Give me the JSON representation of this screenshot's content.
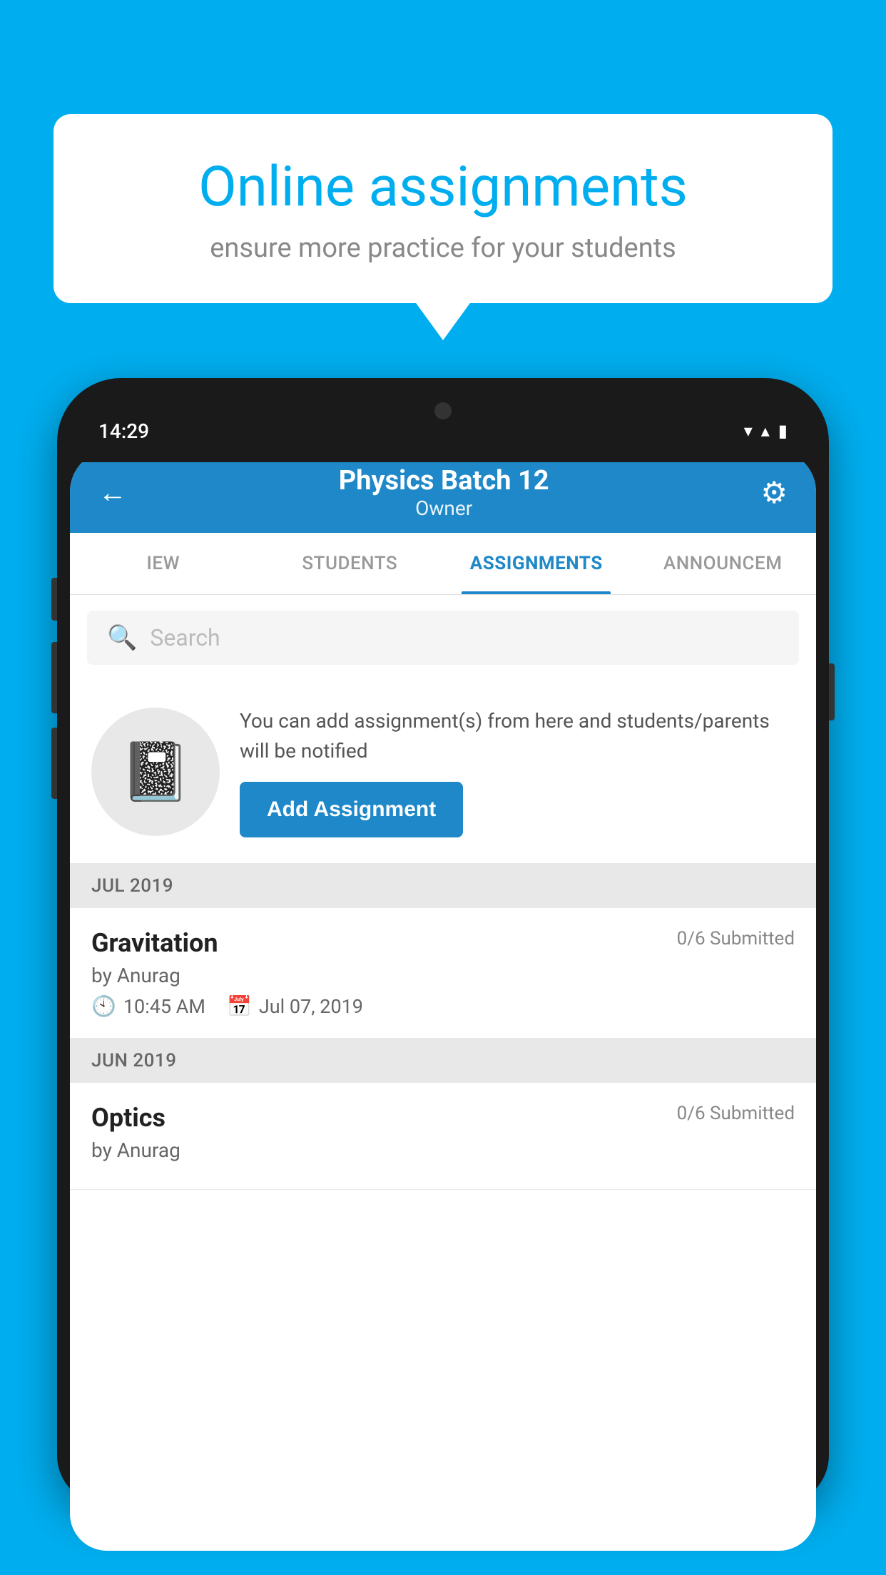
{
  "background_color": "#00AEEF",
  "speech_bubble": {
    "title": "Online assignments",
    "subtitle": "ensure more practice for your students"
  },
  "phone": {
    "status_bar": {
      "time": "14:29"
    },
    "header": {
      "title": "Physics Batch 12",
      "subtitle": "Owner",
      "back_label": "←",
      "settings_label": "⚙"
    },
    "tabs": [
      {
        "label": "IEW",
        "active": false
      },
      {
        "label": "STUDENTS",
        "active": false
      },
      {
        "label": "ASSIGNMENTS",
        "active": true
      },
      {
        "label": "ANNOUNCEM",
        "active": false
      }
    ],
    "search": {
      "placeholder": "Search"
    },
    "promo": {
      "description": "You can add assignment(s) from here and students/parents will be notified",
      "button_label": "Add Assignment"
    },
    "sections": [
      {
        "header": "JUL 2019",
        "assignments": [
          {
            "title": "Gravitation",
            "submitted": "0/6 Submitted",
            "by": "by Anurag",
            "time": "10:45 AM",
            "date": "Jul 07, 2019"
          }
        ]
      },
      {
        "header": "JUN 2019",
        "assignments": [
          {
            "title": "Optics",
            "submitted": "0/6 Submitted",
            "by": "by Anurag",
            "time": "",
            "date": ""
          }
        ]
      }
    ]
  }
}
